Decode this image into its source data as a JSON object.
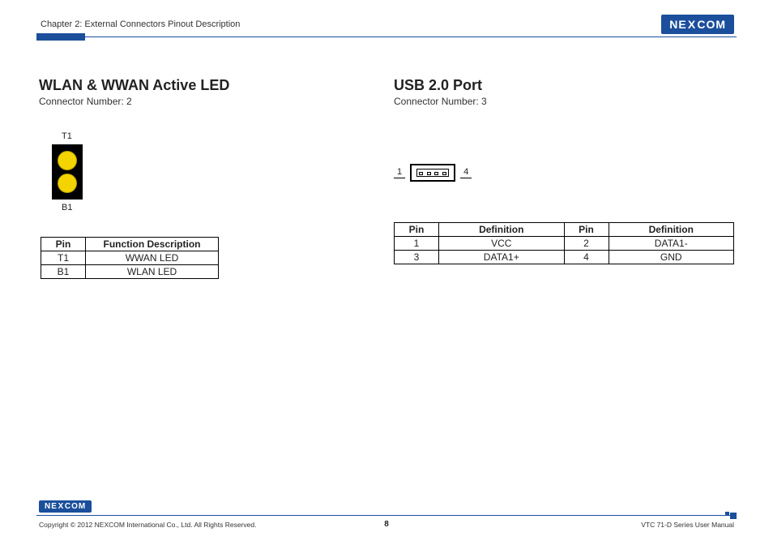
{
  "header": {
    "chapter": "Chapter 2: External Connectors Pinout Description",
    "logo_text": "NEXCOM"
  },
  "left": {
    "title": "WLAN & WWAN Active LED",
    "subtitle": "Connector Number: 2",
    "diagram": {
      "top_label": "T1",
      "bottom_label": "B1"
    },
    "table": {
      "headers": [
        "Pin",
        "Function Description"
      ],
      "rows": [
        [
          "T1",
          "WWAN LED"
        ],
        [
          "B1",
          "WLAN LED"
        ]
      ]
    }
  },
  "right": {
    "title": "USB 2.0 Port",
    "subtitle": "Connector Number: 3",
    "diagram": {
      "left_num": "1",
      "right_num": "4"
    },
    "table": {
      "headers": [
        "Pin",
        "Definition",
        "Pin",
        "Definition"
      ],
      "rows": [
        [
          "1",
          "VCC",
          "2",
          "DATA1-"
        ],
        [
          "3",
          "DATA1+",
          "4",
          "GND"
        ]
      ]
    }
  },
  "footer": {
    "logo_text": "NEXCOM",
    "copyright": "Copyright © 2012 NEXCOM International Co., Ltd. All Rights Reserved.",
    "page": "8",
    "manual": "VTC 71-D Series User Manual"
  }
}
